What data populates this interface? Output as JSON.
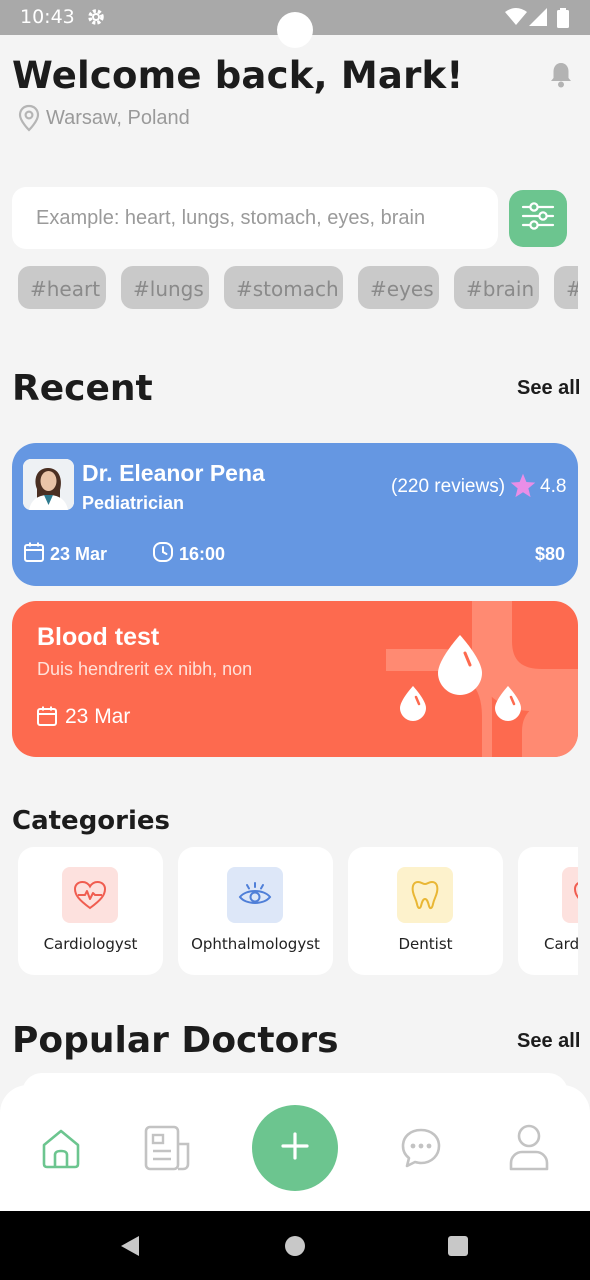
{
  "status_bar": {
    "time": "10:43"
  },
  "header": {
    "greeting": "Welcome back, Mark!",
    "location": "Warsaw, Poland"
  },
  "search": {
    "placeholder": "Example: heart, lungs, stomach, eyes, brain",
    "value": ""
  },
  "tags": [
    "#heart",
    "#lungs",
    "#stomach",
    "#eyes",
    "#brain",
    "#s"
  ],
  "recent": {
    "title": "Recent",
    "see_all": "See all",
    "appointment": {
      "doctor_name": "Dr. Eleanor Pena",
      "specialty": "Pediatrician",
      "reviews": "(220 reviews)",
      "rating": "4.8",
      "date": "23 Mar",
      "time": "16:00",
      "price": "$80"
    },
    "test": {
      "title": "Blood test",
      "subtitle": "Duis hendrerit ex nibh, non",
      "date": "23 Mar"
    }
  },
  "categories": {
    "title": "Categories",
    "items": [
      {
        "label": "Cardiologyst",
        "icon": "heart-pulse-icon"
      },
      {
        "label": "Ophthalmologyst",
        "icon": "eye-icon"
      },
      {
        "label": "Dentist",
        "icon": "tooth-icon"
      },
      {
        "label": "Card",
        "icon": "heart-pulse-icon"
      }
    ]
  },
  "popular": {
    "title": "Popular Doctors",
    "see_all": "See all"
  },
  "bottom_nav": [
    "home-icon",
    "document-icon",
    "add-icon",
    "chat-icon",
    "profile-icon"
  ],
  "colors": {
    "accent_green": "#6cc58f",
    "appointment_blue": "#6597e2",
    "test_orange": "#fd6a4f",
    "star_pink": "#e98ee7"
  }
}
